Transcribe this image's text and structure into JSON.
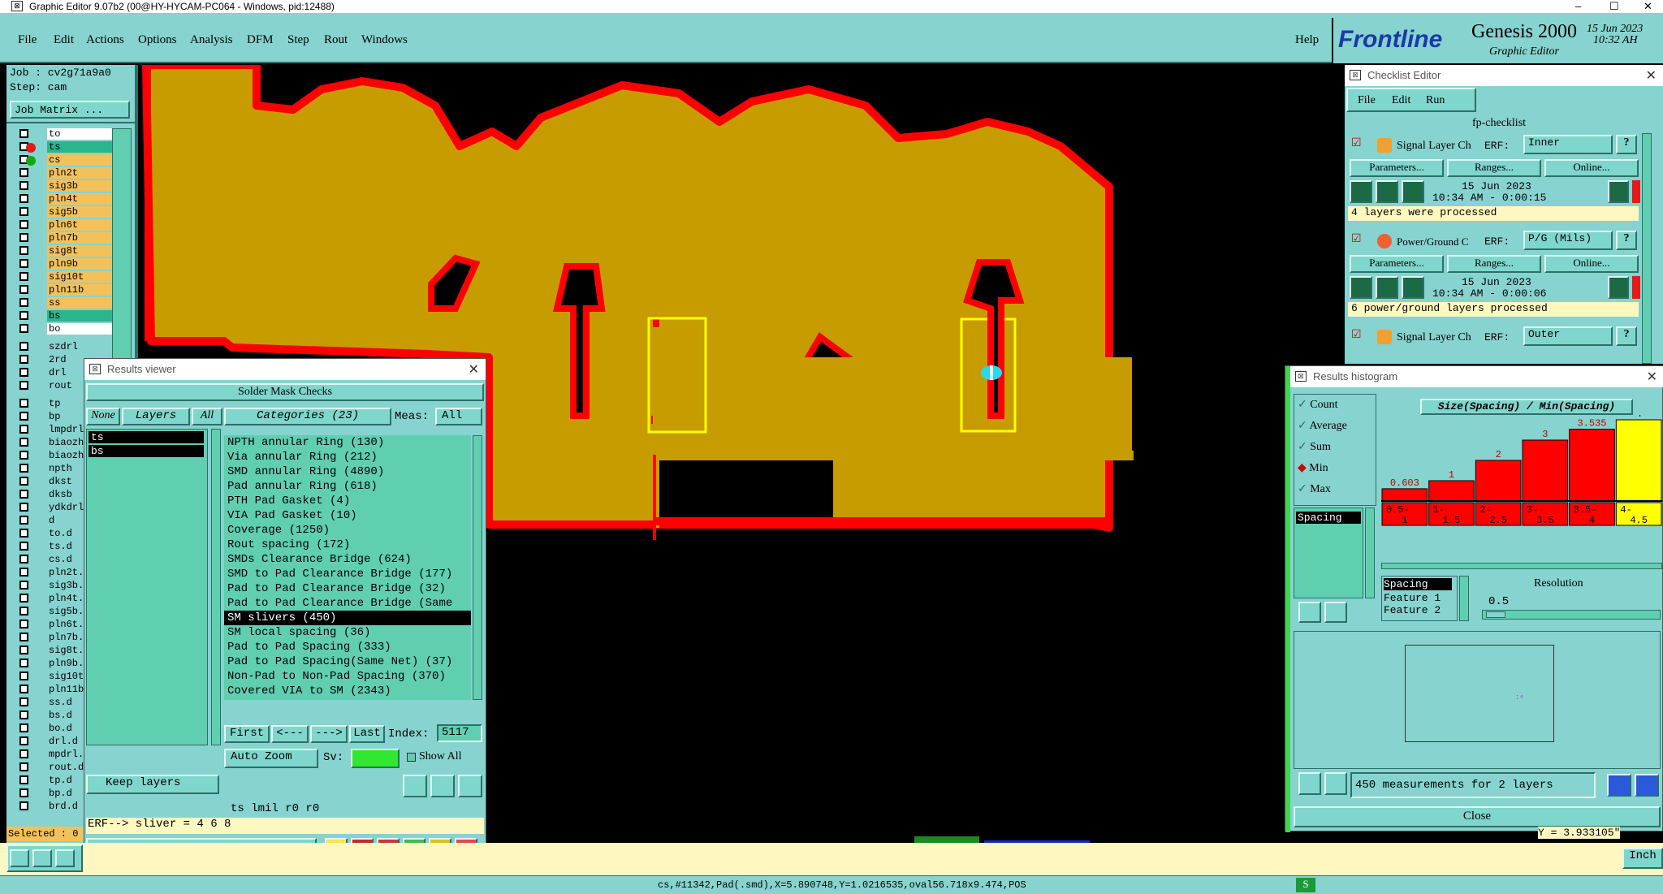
{
  "window": {
    "title": "Graphic Editor 9.07b2 (00@HY-HYCAM-PC064 - Windows, pid:12488)",
    "min": "–",
    "max": "☐",
    "close": "✕"
  },
  "menu": [
    "File",
    "Edit",
    "Actions",
    "Options",
    "Analysis",
    "DFM",
    "Step",
    "Rout",
    "Windows"
  ],
  "help": "Help",
  "brand": {
    "logo": "Frontline",
    "product": "Genesis 2000",
    "sub": "Graphic Editor",
    "date": "15 Jun 2023",
    "time": "10:32 AH"
  },
  "job": {
    "job": "Job : cv2g71a9a0",
    "step": "Step: cam",
    "matrix": "Job Matrix ..."
  },
  "layers": [
    {
      "n": "to",
      "c": "#ffffff"
    },
    {
      "n": "ts",
      "c": "#2bb58c"
    },
    {
      "n": "cs",
      "c": "#f2c15b"
    },
    {
      "n": "pln2t",
      "c": "#f2c15b"
    },
    {
      "n": "sig3b",
      "c": "#f2c15b"
    },
    {
      "n": "pln4t",
      "c": "#f2c15b"
    },
    {
      "n": "sig5b",
      "c": "#f2c15b"
    },
    {
      "n": "pln6t",
      "c": "#f2c15b"
    },
    {
      "n": "pln7b",
      "c": "#f2c15b"
    },
    {
      "n": "sig8t",
      "c": "#f2c15b"
    },
    {
      "n": "pln9b",
      "c": "#f2c15b"
    },
    {
      "n": "sig10t",
      "c": "#f2c15b"
    },
    {
      "n": "pln11b",
      "c": "#f2c15b"
    },
    {
      "n": "ss",
      "c": "#f2c15b"
    },
    {
      "n": "bs",
      "c": "#2bb58c"
    },
    {
      "n": "bo",
      "c": "#ffffff"
    }
  ],
  "layers2": [
    "szdrl",
    "2rd",
    "drl",
    "rout"
  ],
  "layers3": [
    "tp",
    "bp",
    "lmpdrl",
    "biaozhu",
    "biaozhu",
    "npth",
    "dkst",
    "dksb",
    "ydkdrl",
    "d",
    "to.d",
    "ts.d",
    "cs.d",
    "pln2t.d",
    "sig3b.d",
    "pln4t.d",
    "sig5b.d",
    "pln6t.d",
    "pln7b.d",
    "sig8t.d",
    "pln9b.d",
    "sig10t.d",
    "pln11b.d",
    "ss.d",
    "bs.d",
    "bo.d",
    "drl.d",
    "mpdrl.d",
    "rout.d",
    "tp.d",
    "bp.d",
    "brd.d"
  ],
  "selected": "Selected : 0",
  "results_viewer": {
    "title": "Results viewer",
    "header": "Solder Mask Checks",
    "none": "None",
    "layers": "Layers",
    "all": "All",
    "layer_list": [
      "ts",
      "bs"
    ],
    "categories": "Categories (23)",
    "meas_label": "Meas:",
    "meas_value": "All",
    "items": [
      "NPTH annular Ring (130)",
      "Via annular Ring (212)",
      "SMD annular Ring (4890)",
      "Pad annular Ring (618)",
      "PTH Pad Gasket (4)",
      "VIA Pad Gasket (10)",
      "Coverage (1250)",
      "Rout spacing (172)",
      "SMDs Clearance Bridge (624)",
      "SMD to Pad Clearance Bridge (177)",
      "Pad to Pad Clearance Bridge (32)",
      "Pad to Pad Clearance Bridge (Same",
      "SM slivers (450)",
      "SM local spacing (36)",
      "Pad to Pad Spacing (333)",
      "Pad to Pad Spacing(Same Net) (37)",
      "Non-Pad to Non-Pad Spacing (370)",
      "Covered VIA to SM (2343)"
    ],
    "selected_index": 12,
    "first": "First",
    "prev": "<---",
    "next": "--->",
    "last": "Last",
    "index_label": "Index:",
    "index_value": "5117",
    "auto_zoom": "Auto Zoom",
    "sv": "Sv:",
    "show_all": "Show All",
    "keep_layers": "Keep layers",
    "info": "ts lmil  r0  r0",
    "erf": "ERF--> sliver = 4 6 8",
    "close": "Close"
  },
  "checklist": {
    "title": "Checklist Editor",
    "menu": [
      "File",
      "Edit",
      "Run"
    ],
    "name": "fp-checklist",
    "rows": [
      {
        "name": "Signal Layer Ch",
        "erf": "Inner",
        "date": "15 Jun 2023",
        "time": "10:34 AM - 0:00:15",
        "msg": "4 layers were processed"
      },
      {
        "name": "Power/Ground C",
        "erf": "P/G (Mils)",
        "date": "15 Jun 2023",
        "time": "10:34 AM - 0:00:06",
        "msg": "6 power/ground layers processed"
      },
      {
        "name": "Signal Layer Ch",
        "erf": "Outer"
      }
    ],
    "erf_label": "ERF:",
    "params": "Parameters...",
    "ranges": "Ranges...",
    "online": "Online...",
    "q": "?"
  },
  "histogram": {
    "title": "Results histogram",
    "options": [
      "Count",
      "Average",
      "Sum",
      "Min",
      "Max"
    ],
    "selected_option": "Min",
    "chart_title": "Size(Spacing) / Min(Spacing)",
    "list_item": "Spacing",
    "measures": [
      "Spacing",
      "Feature 1",
      "Feature 2"
    ],
    "resolution_label": "Resolution",
    "resolution": "0.5",
    "summary": "450 measurements for 2 layers",
    "close": "Close",
    "y_readout": "Y = 3.933105\"",
    "inch": "Inch"
  },
  "chart_data": {
    "type": "bar",
    "title": "Size(Spacing) / Min(Spacing)",
    "categories": [
      "0.5-1",
      "1-1.5",
      "2-2.5",
      "3-3.5",
      "3.5-4",
      "4-4.5"
    ],
    "values": [
      0.603,
      1,
      2,
      3,
      3.535,
      4
    ],
    "labels": [
      "0.603",
      "1",
      "2",
      "3",
      "3.535",
      "4"
    ],
    "colors": [
      "#ff0000",
      "#ff0000",
      "#ff0000",
      "#ff0000",
      "#ff0000",
      "#ffff00"
    ],
    "ylim": [
      0,
      4
    ]
  },
  "status": "cs,#11342,Pad(.smd),X=5.890748,Y=1.0216535,oval56.718x9.474,POS"
}
